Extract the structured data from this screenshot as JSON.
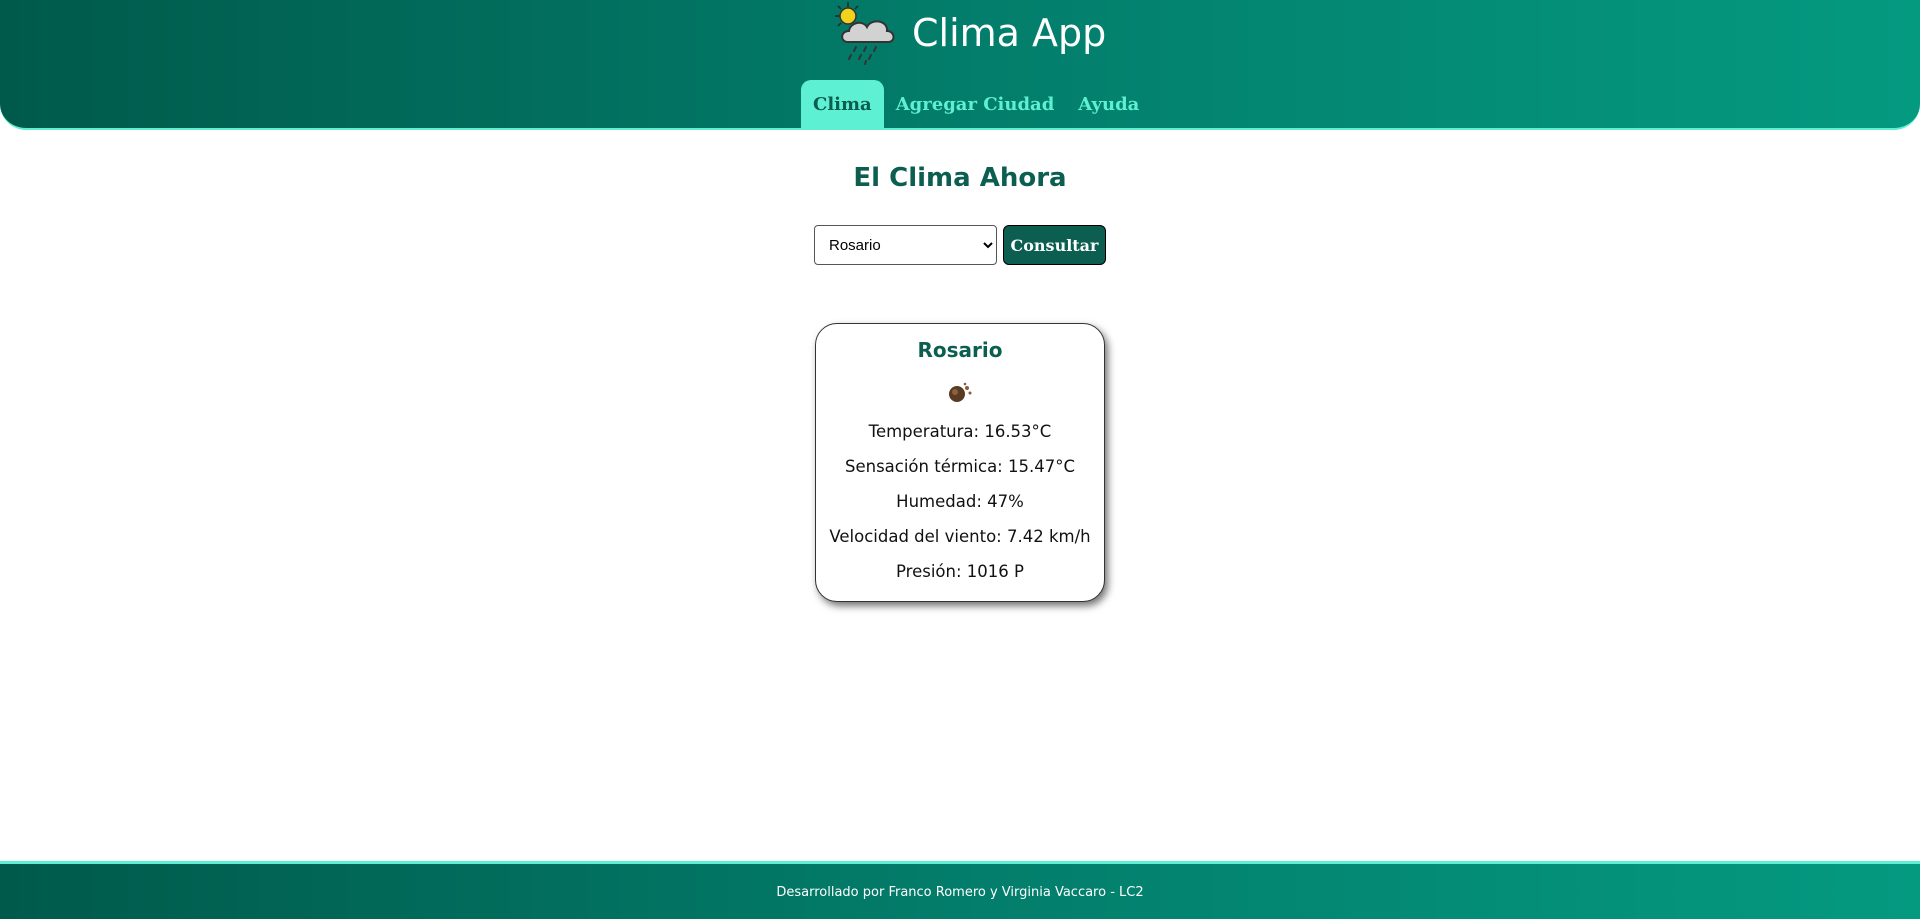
{
  "header": {
    "app_title": "Clima App",
    "logo_icon": "sun-cloud-rain-icon",
    "nav": [
      {
        "label": "Clima",
        "active": true
      },
      {
        "label": "Agregar Ciudad",
        "active": false
      },
      {
        "label": "Ayuda",
        "active": false
      }
    ]
  },
  "main": {
    "title": "El Clima Ahora",
    "city_select": {
      "selected": "Rosario",
      "options": [
        "Rosario"
      ]
    },
    "consult_label": "Consultar"
  },
  "card": {
    "city": "Rosario",
    "weather_icon": "weather-condition-icon",
    "temperature": "Temperatura: 16.53°C",
    "feels_like": "Sensación térmica: 15.47°C",
    "humidity": "Humedad: 47%",
    "wind": "Velocidad del viento: 7.42 km/h",
    "pressure": "Presión: 1016 P"
  },
  "footer": {
    "text": "Desarrollado por Franco Romero y Virginia Vaccaro - LC2"
  },
  "colors": {
    "primary_dark": "#005a4b",
    "primary": "#037d6b",
    "accent": "#5ef0d2",
    "title": "#0b5e50"
  }
}
